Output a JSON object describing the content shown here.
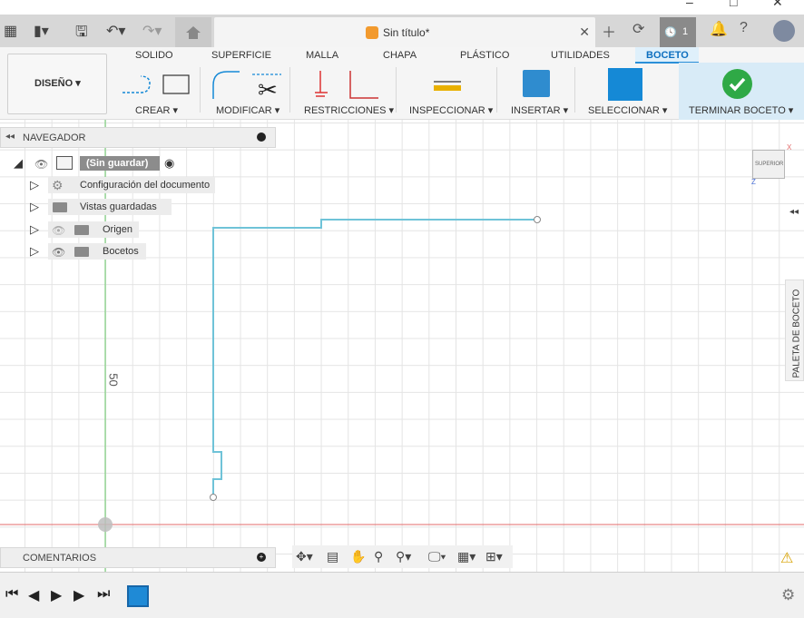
{
  "document": {
    "title": "Sin título*"
  },
  "titlebar": {
    "clock_count": "1"
  },
  "ribbon": {
    "tabs": [
      "SOLIDO",
      "SUPERFICIE",
      "MALLA",
      "CHAPA",
      "PLÁSTICO",
      "UTILIDADES",
      "BOCETO"
    ],
    "active_tab": "BOCETO",
    "workspace": "DISEÑO ▾",
    "groups": {
      "crear": "CREAR ▾",
      "modificar": "MODIFICAR ▾",
      "restricciones": "RESTRICCIONES ▾",
      "inspeccionar": "INSPECCIONAR ▾",
      "insertar": "INSERTAR ▾",
      "seleccionar": "SELECCIONAR ▾",
      "terminar": "TERMINAR BOCETO ▾"
    }
  },
  "navigator": {
    "title": "NAVEGADOR",
    "root": "(Sin guardar)",
    "items": [
      "Configuración del documento",
      "Vistas guardadas",
      "Origen",
      "Bocetos"
    ]
  },
  "canvas": {
    "axis_label": "50",
    "viewcube_label": "SUPERIOR",
    "axis_x": "X",
    "axis_z": "Z"
  },
  "palette": {
    "label": "PALETA DE BOCETO"
  },
  "comments": {
    "title": "COMENTARIOS"
  },
  "colors": {
    "sketch_line": "#6fc3d8",
    "accent": "#1589d6",
    "finish_check": "#2fa946",
    "x_axis": "#e36b6b",
    "y_axis": "#7fcf7f"
  }
}
